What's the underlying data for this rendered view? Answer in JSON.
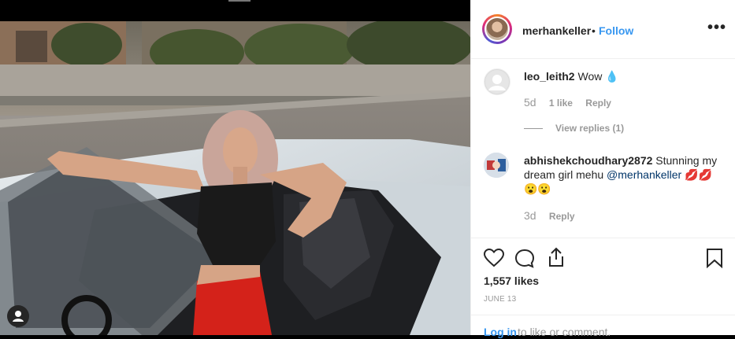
{
  "post": {
    "username": "merhankeller",
    "separator": "•",
    "follow_label": "Follow",
    "more_icon": "•••"
  },
  "comments": [
    {
      "username": "leo_leith2",
      "text": "Wow",
      "emoji": "💧",
      "time": "5d",
      "likes": "1 like",
      "reply_label": "Reply",
      "view_replies": "View replies (1)"
    },
    {
      "username": "abhishekchoudhary2872",
      "text_before": "Stunning my dream girl mehu",
      "mention": "@merhankeller",
      "emoji_1": "💋💋",
      "emoji_2": "😮😮",
      "time": "3d",
      "reply_label": "Reply"
    }
  ],
  "engagement": {
    "likes": "1,557 likes",
    "date": "JUNE 13"
  },
  "login": {
    "link": "Log in",
    "rest": "to like or comment."
  },
  "icons": {
    "like": "heart-icon",
    "comment": "comment-icon",
    "share": "share-icon",
    "save": "bookmark-icon",
    "user_tags": "person-icon"
  },
  "colors": {
    "link": "#3897f0",
    "text": "#262626",
    "muted": "#999999",
    "mention": "#003569"
  }
}
